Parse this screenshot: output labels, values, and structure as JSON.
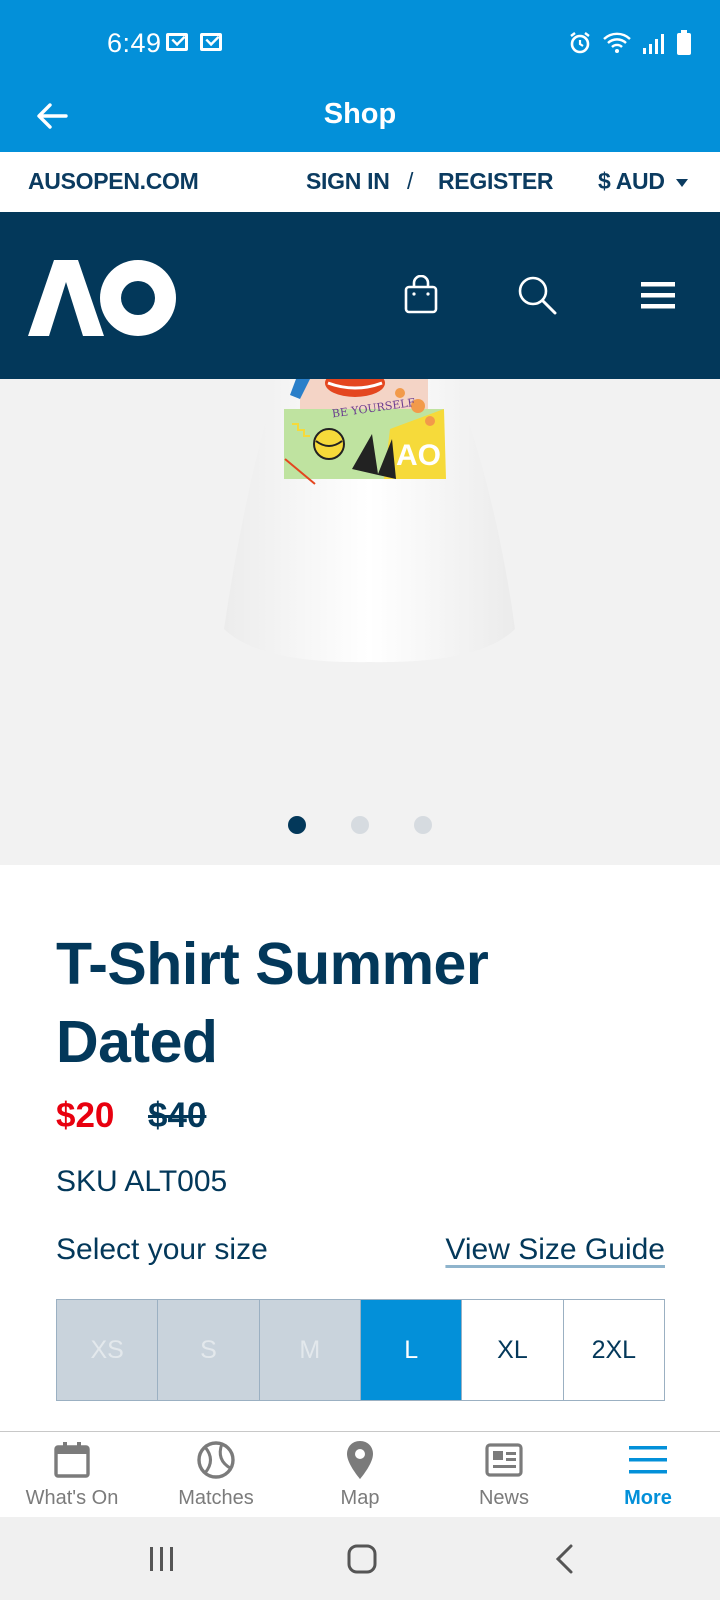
{
  "status_bar": {
    "time": "6:49",
    "icons": [
      "mail-icon",
      "mail-icon",
      "alarm-icon",
      "wifi-icon",
      "signal-icon",
      "battery-icon"
    ]
  },
  "header": {
    "title": "Shop",
    "back_icon": "arrow-left-icon"
  },
  "utility_bar": {
    "site_link": "AUSOPEN.COM",
    "sign_in": "SIGN IN",
    "separator": "/",
    "register": "REGISTER",
    "currency": "$ AUD"
  },
  "nav": {
    "logo": "AO",
    "icons": [
      "shopping-bag-icon",
      "search-icon",
      "hamburger-menu-icon"
    ]
  },
  "product_image": {
    "print_text": "BE YOURSELF",
    "print_logo": "AO",
    "carousel_count": 3,
    "carousel_active": 1
  },
  "product": {
    "title": "T-Shirt Summer Dated",
    "price_now": "$20",
    "price_was": "$40",
    "sku": "SKU ALT005",
    "size_prompt": "Select your size",
    "size_guide_link": "View Size Guide",
    "sizes": [
      {
        "label": "XS",
        "state": "disabled"
      },
      {
        "label": "S",
        "state": "disabled"
      },
      {
        "label": "M",
        "state": "disabled"
      },
      {
        "label": "L",
        "state": "selected"
      },
      {
        "label": "XL",
        "state": "available"
      },
      {
        "label": "2XL",
        "state": "available"
      }
    ]
  },
  "tab_bar": {
    "tabs": [
      {
        "label": "What's On",
        "icon": "calendar-icon",
        "active": false
      },
      {
        "label": "Matches",
        "icon": "tennis-ball-icon",
        "active": false
      },
      {
        "label": "Map",
        "icon": "map-pin-icon",
        "active": false
      },
      {
        "label": "News",
        "icon": "newspaper-icon",
        "active": false
      },
      {
        "label": "More",
        "icon": "hamburger-menu-icon",
        "active": true
      }
    ]
  },
  "colors": {
    "brand_blue": "#0390d9",
    "navy": "#03385a",
    "sale_red": "#e8000f"
  }
}
